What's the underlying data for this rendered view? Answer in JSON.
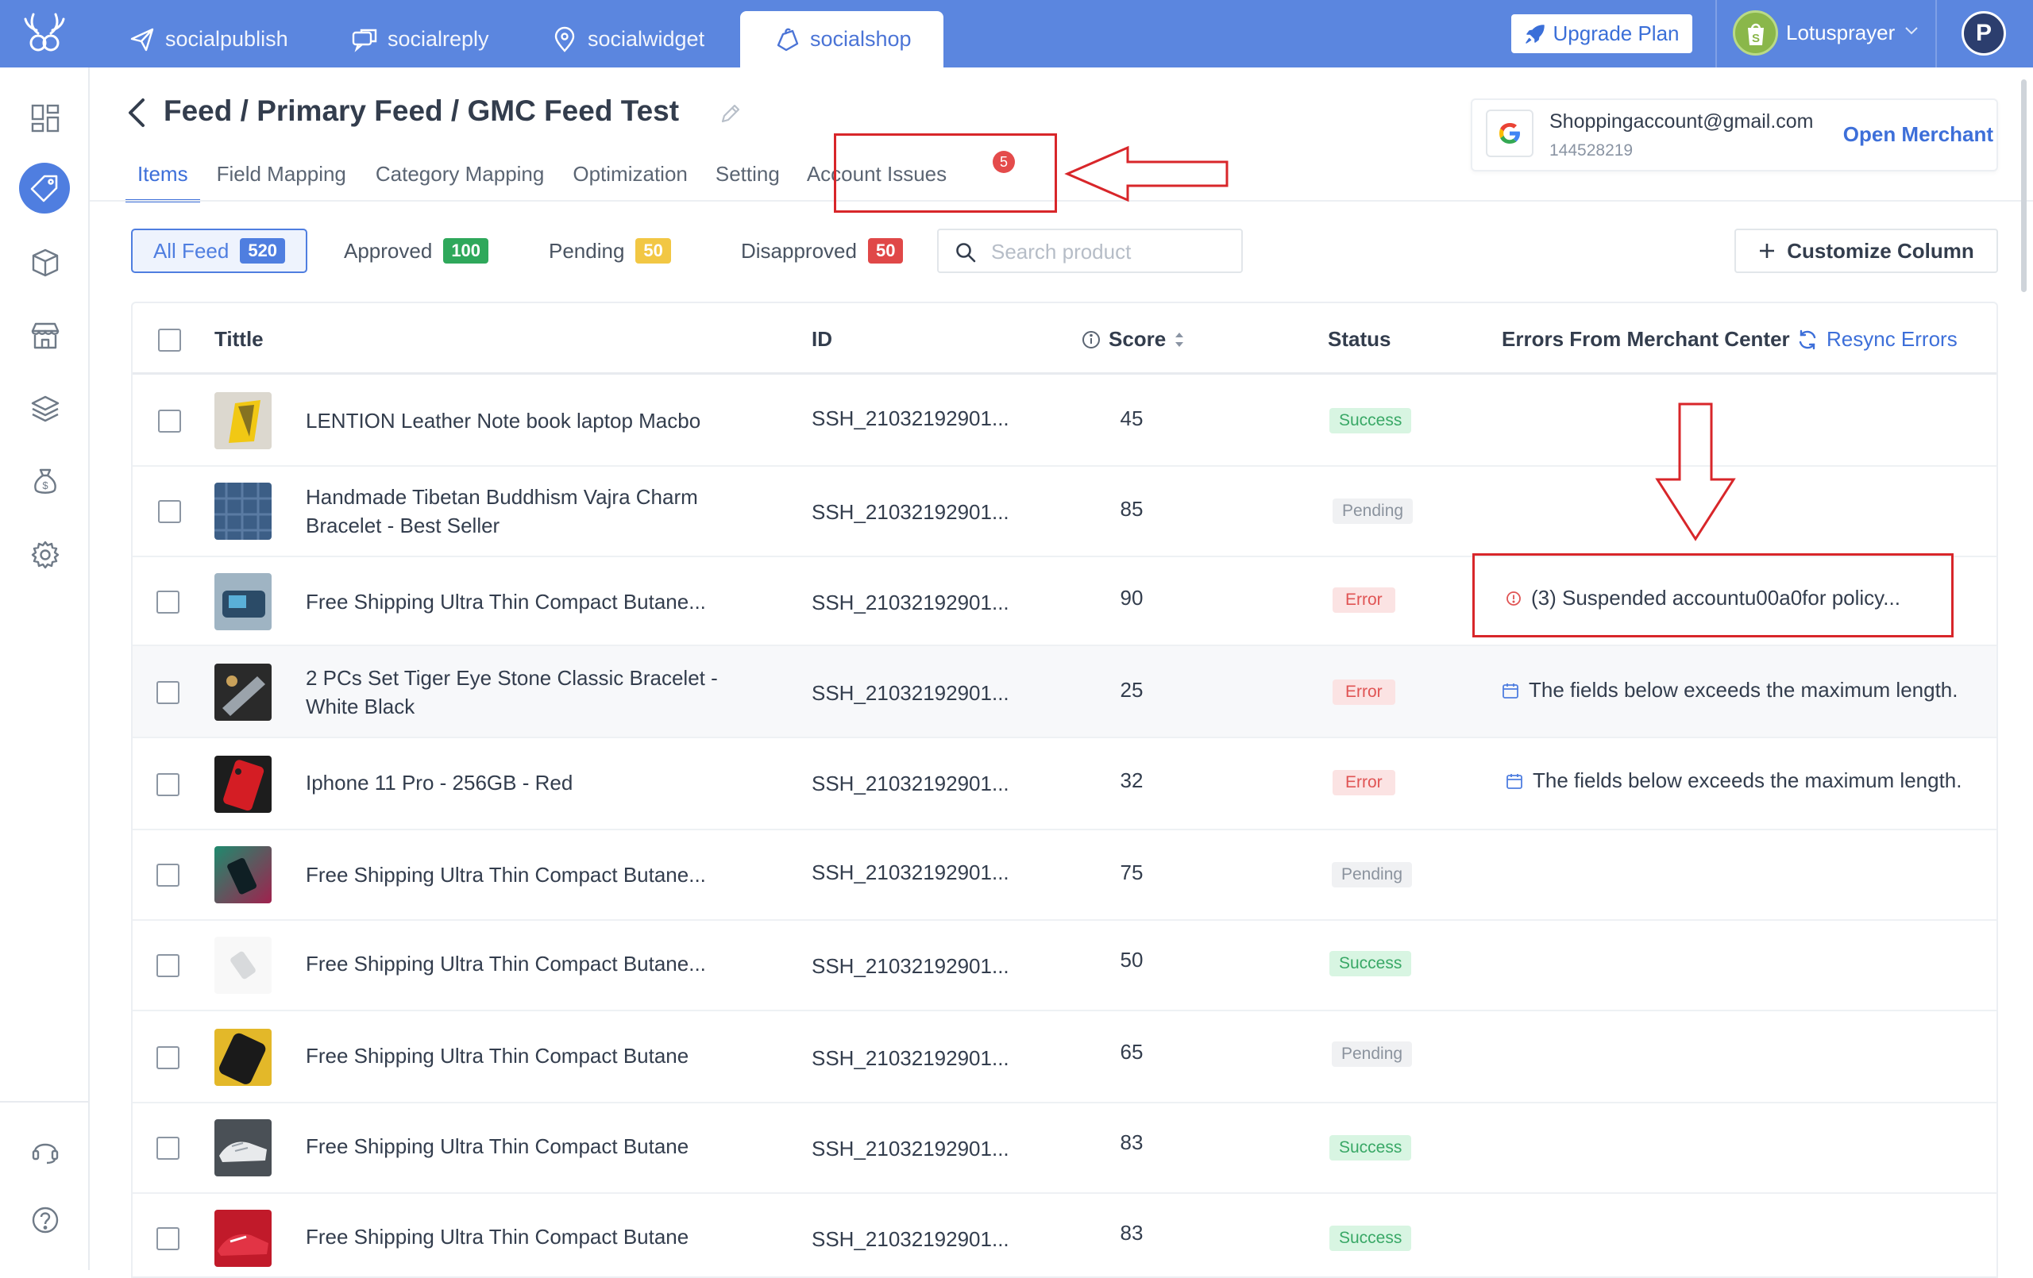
{
  "top_nav": {
    "tabs": [
      {
        "label": "socialpublish",
        "icon": "paper-plane-icon"
      },
      {
        "label": "socialreply",
        "icon": "chat-bubbles-icon"
      },
      {
        "label": "socialwidget",
        "icon": "widget-pin-icon"
      },
      {
        "label": "socialshop",
        "icon": "shopping-bag-icon",
        "active": true
      }
    ],
    "upgrade_label": "Upgrade Plan",
    "store_name": "Lotusprayer",
    "avatar_letter": "P"
  },
  "sidebar": {
    "items": [
      "dashboard-icon",
      "tag-icon",
      "box-icon",
      "store-icon",
      "layers-icon",
      "money-bag-icon",
      "settings-icon"
    ],
    "bottom": [
      "support-headset-icon",
      "help-icon"
    ],
    "active": "tag-icon"
  },
  "header": {
    "breadcrumb": "Feed / Primary Feed / GMC Feed Test",
    "tabs": [
      "Items",
      "Field Mapping",
      "Category Mapping",
      "Optimization",
      "Setting",
      "Account Issues"
    ],
    "active_tab": "Items",
    "account_issues_count": "5"
  },
  "merchant": {
    "email": "Shoppingaccount@gmail.com",
    "account_id": "144528219",
    "open_label": "Open Merchant"
  },
  "filters": {
    "all": {
      "label": "All Feed",
      "count": "520"
    },
    "approved": {
      "label": "Approved",
      "count": "100"
    },
    "pending": {
      "label": "Pending",
      "count": "50"
    },
    "disapproved": {
      "label": "Disapproved",
      "count": "50"
    },
    "search_placeholder": "Search product",
    "customize_label": "Customize Column"
  },
  "colors": {
    "brand": "#5b86df",
    "accent": "#3d6fd9",
    "approved": "#2fa85b",
    "pending": "#f2c744",
    "disapproved": "#e04848",
    "annotation": "#d8262a"
  },
  "table": {
    "headers": {
      "title": "Tittle",
      "id": "ID",
      "score": "Score",
      "status": "Status",
      "errors": "Errors From Merchant Center",
      "resync": "Resync Errors"
    },
    "rows": [
      {
        "title": "LENTION Leather Note book laptop Macbo",
        "id": "SSH_21032192901...",
        "score": "45",
        "status": "Success",
        "error": ""
      },
      {
        "title": " Handmade Tibetan Buddhism Vajra Charm Bracelet - Best Seller",
        "id": "SSH_21032192901...",
        "score": "85",
        "status": "Pending",
        "error": ""
      },
      {
        "title": "Free Shipping Ultra Thin Compact Butane...",
        "id": "SSH_21032192901...",
        "score": "90",
        "status": "Error",
        "error": "(3) Suspended accountu00a0for policy..."
      },
      {
        "title": " 2 PCs Set Tiger Eye Stone Classic Bracelet - White Black",
        "id": "SSH_21032192901...",
        "score": "25",
        "status": "Error",
        "error": "The fields below exceeds the maximum length."
      },
      {
        "title": "Iphone 11 Pro - 256GB - Red",
        "id": "SSH_21032192901...",
        "score": "32",
        "status": "Error",
        "error": "The fields below exceeds the maximum length."
      },
      {
        "title": "Free Shipping Ultra Thin Compact Butane...",
        "id": "SSH_21032192901...",
        "score": "75",
        "status": "Pending",
        "error": ""
      },
      {
        "title": "Free Shipping Ultra Thin Compact Butane...",
        "id": "SSH_21032192901...",
        "score": "50",
        "status": "Success",
        "error": ""
      },
      {
        "title": "Free Shipping Ultra Thin Compact Butane",
        "id": "SSH_21032192901...",
        "score": "65",
        "status": "Pending",
        "error": ""
      },
      {
        "title": "Free Shipping Ultra Thin Compact Butane",
        "id": "SSH_21032192901...",
        "score": "83",
        "status": "Success",
        "error": ""
      },
      {
        "title": "Free Shipping Ultra Thin Compact Butane",
        "id": "SSH_21032192901...",
        "score": "83",
        "status": "Success",
        "error": ""
      }
    ]
  }
}
